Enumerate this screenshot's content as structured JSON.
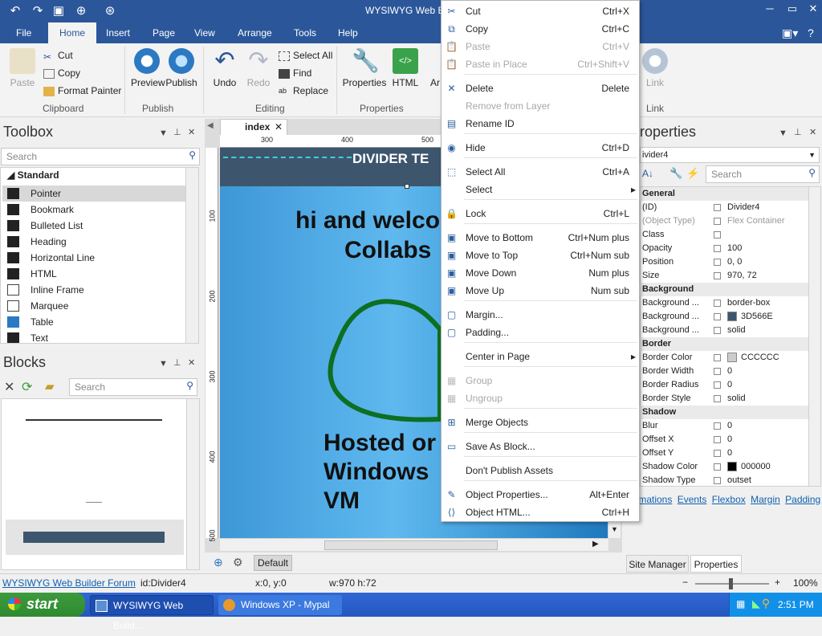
{
  "window": {
    "title": "WYSIWYG Web Build"
  },
  "menu": {
    "tabs": [
      "File",
      "Home",
      "Insert",
      "Page",
      "View",
      "Arrange",
      "Tools",
      "Help"
    ],
    "active": "Home"
  },
  "ribbon": {
    "clipboard": {
      "paste": "Paste",
      "cut": "Cut",
      "copy": "Copy",
      "format_painter": "Format Painter",
      "label": "Clipboard"
    },
    "publish": {
      "preview": "Preview",
      "publish": "Publish",
      "label": "Publish"
    },
    "editing": {
      "undo": "Undo",
      "redo": "Redo",
      "select_all": "Select All",
      "find": "Find",
      "replace": "Replace",
      "label": "Editing"
    },
    "properties": {
      "properties": "Properties",
      "html": "HTML",
      "label": "Properties",
      "clipped": "Ar"
    },
    "link": {
      "link": "Link",
      "label": "Link"
    }
  },
  "toolbox": {
    "title": "Toolbox",
    "search_placeholder": "Search",
    "section": "Standard",
    "items": [
      "Pointer",
      "Bookmark",
      "Bulleted List",
      "Heading",
      "Horizontal Line",
      "HTML",
      "Inline Frame",
      "Marquee",
      "Table",
      "Text"
    ]
  },
  "blocks": {
    "title": "Blocks",
    "search_placeholder": "Search"
  },
  "editor": {
    "tab": "index",
    "ruler_top": [
      "300",
      "400",
      "500"
    ],
    "ruler_left": [
      "100",
      "200",
      "300",
      "400",
      "500"
    ],
    "divider_text": "DIVIDER TE",
    "heading_line1": "hi and welco",
    "heading_line2": "Collabs",
    "hosted_line1": "Hosted or",
    "hosted_line2": "Windows",
    "hosted_line3": "VM",
    "page_selector": "Default"
  },
  "context_menu": {
    "items": [
      {
        "label": "Cut",
        "shortcut": "Ctrl+X",
        "enabled": true,
        "icon": "scissors-icon"
      },
      {
        "label": "Copy",
        "shortcut": "Ctrl+C",
        "enabled": true,
        "icon": "copy-icon"
      },
      {
        "label": "Paste",
        "shortcut": "Ctrl+V",
        "enabled": false,
        "icon": "paste-icon"
      },
      {
        "label": "Paste in Place",
        "shortcut": "Ctrl+Shift+V",
        "enabled": false,
        "icon": "paste-in-place-icon"
      },
      {
        "label": "Delete",
        "shortcut": "Delete",
        "enabled": true,
        "icon": "delete-icon"
      },
      {
        "label": "Remove from Layer",
        "shortcut": "",
        "enabled": false,
        "icon": ""
      },
      {
        "label": "Rename ID",
        "shortcut": "",
        "enabled": true,
        "icon": "rename-icon"
      },
      {
        "label": "Hide",
        "shortcut": "Ctrl+D",
        "enabled": true,
        "icon": "hide-icon"
      },
      {
        "label": "Select All",
        "shortcut": "Ctrl+A",
        "enabled": true,
        "icon": "select-all-icon"
      },
      {
        "label": "Select",
        "shortcut": "",
        "enabled": true,
        "icon": "",
        "submenu": true
      },
      {
        "label": "Lock",
        "shortcut": "Ctrl+L",
        "enabled": true,
        "icon": "lock-icon"
      },
      {
        "label": "Move to Bottom",
        "shortcut": "Ctrl+Num plus",
        "enabled": true,
        "icon": "move-bottom-icon"
      },
      {
        "label": "Move to Top",
        "shortcut": "Ctrl+Num sub",
        "enabled": true,
        "icon": "move-top-icon"
      },
      {
        "label": "Move Down",
        "shortcut": "Num plus",
        "enabled": true,
        "icon": "move-down-icon"
      },
      {
        "label": "Move Up",
        "shortcut": "Num sub",
        "enabled": true,
        "icon": "move-up-icon"
      },
      {
        "label": "Margin...",
        "shortcut": "",
        "enabled": true,
        "icon": "margin-icon"
      },
      {
        "label": "Padding...",
        "shortcut": "",
        "enabled": true,
        "icon": "padding-icon"
      },
      {
        "label": "Center in Page",
        "shortcut": "",
        "enabled": true,
        "icon": "",
        "submenu": true
      },
      {
        "label": "Group",
        "shortcut": "",
        "enabled": false,
        "icon": "group-icon"
      },
      {
        "label": "Ungroup",
        "shortcut": "",
        "enabled": false,
        "icon": "ungroup-icon"
      },
      {
        "label": "Merge Objects",
        "shortcut": "",
        "enabled": true,
        "icon": "merge-icon"
      },
      {
        "label": "Save As Block...",
        "shortcut": "",
        "enabled": true,
        "icon": "save-block-icon"
      },
      {
        "label": "Don't Publish Assets",
        "shortcut": "",
        "enabled": true,
        "icon": ""
      },
      {
        "label": "Object Properties...",
        "shortcut": "Alt+Enter",
        "enabled": true,
        "icon": "object-properties-icon"
      },
      {
        "label": "Object HTML...",
        "shortcut": "Ctrl+H",
        "enabled": true,
        "icon": "object-html-icon"
      }
    ]
  },
  "properties": {
    "title": "roperties",
    "object": "ivider4",
    "search_placeholder": "Search",
    "rows": [
      {
        "name": "General",
        "category": true
      },
      {
        "name": "(ID)",
        "value": "Divider4"
      },
      {
        "name": "(Object Type)",
        "value": "Flex Container",
        "dim": true
      },
      {
        "name": "Class",
        "value": ""
      },
      {
        "name": "Opacity",
        "value": "100"
      },
      {
        "name": "Position",
        "value": "0, 0"
      },
      {
        "name": "Size",
        "value": "970, 72"
      },
      {
        "name": "Background",
        "category": true
      },
      {
        "name": "Background ...",
        "value": "border-box"
      },
      {
        "name": "Background ...",
        "value": "3D566E",
        "swatch": "#3D566E"
      },
      {
        "name": "Background ...",
        "value": "solid"
      },
      {
        "name": "Border",
        "category": true
      },
      {
        "name": "Border Color",
        "value": "CCCCCC",
        "swatch": "#CCCCCC"
      },
      {
        "name": "Border Width",
        "value": "0"
      },
      {
        "name": "Border Radius",
        "value": "0"
      },
      {
        "name": "Border Style",
        "value": "solid"
      },
      {
        "name": "Shadow",
        "category": true
      },
      {
        "name": "Blur",
        "value": "0"
      },
      {
        "name": "Offset X",
        "value": "0"
      },
      {
        "name": "Offset Y",
        "value": "0"
      },
      {
        "name": "Shadow Color",
        "value": "000000",
        "swatch": "#000000"
      },
      {
        "name": "Shadow Type",
        "value": "outset"
      }
    ],
    "links": [
      "nimations",
      "Events",
      "Flexbox",
      "Margin",
      "Padding"
    ],
    "bottom_tabs": [
      "Site Manager",
      "Properties"
    ]
  },
  "status": {
    "forum": "WYSIWYG Web Builder Forum",
    "id": "id:Divider4",
    "xy": "x:0, y:0",
    "wh": "w:970 h:72",
    "zoom": "100%"
  },
  "taskbar": {
    "start": "start",
    "items": [
      "WYSIWYG Web Build...",
      "Windows XP - Mypal"
    ],
    "time": "2:51 PM"
  }
}
